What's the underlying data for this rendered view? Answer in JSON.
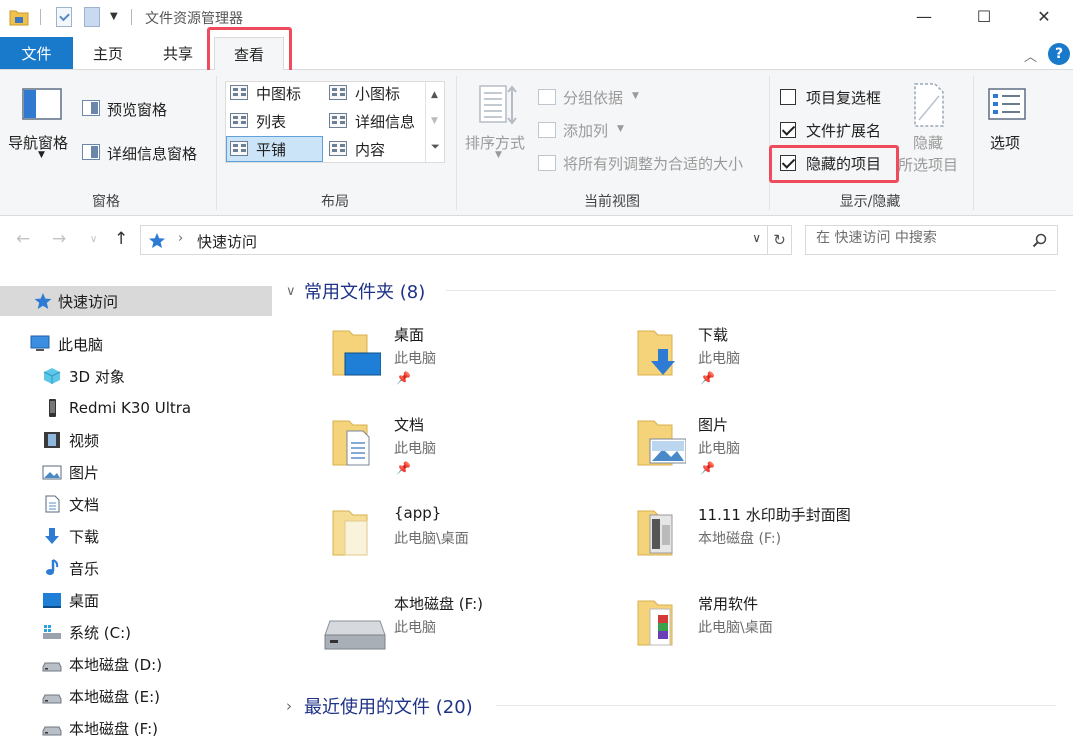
{
  "window": {
    "title": "文件资源管理器",
    "minimize": "—",
    "maximize": "☐",
    "close": "✕"
  },
  "ribbon_tabs": {
    "file": "文件",
    "home": "主页",
    "share": "共享",
    "view": "查看"
  },
  "ribbon": {
    "pane": {
      "nav_pane": "导航窗格",
      "preview_pane": "预览窗格",
      "details_pane": "详细信息窗格",
      "label": "窗格"
    },
    "layout": {
      "items": [
        "中图标",
        "小图标",
        "列表",
        "详细信息",
        "平铺",
        "内容"
      ],
      "selected": "平铺",
      "label": "布局"
    },
    "current_view": {
      "sort_by": "排序方式",
      "group_by": "分组依据",
      "add_column": "添加列",
      "fit_columns": "将所有列调整为合适的大小",
      "label": "当前视图"
    },
    "show_hide": {
      "item_checkboxes": "项目复选框",
      "item_checkboxes_checked": false,
      "file_extensions": "文件扩展名",
      "file_extensions_checked": true,
      "hidden_items": "隐藏的项目",
      "hidden_items_checked": true,
      "hide_selected_line1": "隐藏",
      "hide_selected_line2": "所选项目",
      "label": "显示/隐藏"
    },
    "options": "选项"
  },
  "address": {
    "path": "快速访问",
    "search_placeholder": "在 快速访问 中搜索"
  },
  "nav_pane": {
    "quick_access": "快速访问",
    "this_pc": "此电脑",
    "items": [
      "3D 对象",
      "Redmi K30 Ultra",
      "视频",
      "图片",
      "文档",
      "下载",
      "音乐",
      "桌面",
      "系统 (C:)",
      "本地磁盘 (D:)",
      "本地磁盘 (E:)",
      "本地磁盘 (F:)"
    ]
  },
  "content": {
    "frequent_header": "常用文件夹 (8)",
    "recent_header": "最近使用的文件 (20)",
    "tiles": [
      {
        "name": "桌面",
        "location": "此电脑",
        "pinned": true
      },
      {
        "name": "下载",
        "location": "此电脑",
        "pinned": true
      },
      {
        "name": "文档",
        "location": "此电脑",
        "pinned": true
      },
      {
        "name": "图片",
        "location": "此电脑",
        "pinned": true
      },
      {
        "name": "{app}",
        "location": "此电脑\\桌面",
        "pinned": false
      },
      {
        "name": "11.11 水印助手封面图",
        "location": "本地磁盘 (F:)",
        "pinned": false
      },
      {
        "name": "本地磁盘 (F:)",
        "location": "此电脑",
        "pinned": false
      },
      {
        "name": "常用软件",
        "location": "此电脑\\桌面",
        "pinned": false
      }
    ]
  },
  "colors": {
    "accent": "#1979ca",
    "highlight": "#f04b5c",
    "folder": "#f4d37a",
    "header_text": "#1e3287"
  }
}
